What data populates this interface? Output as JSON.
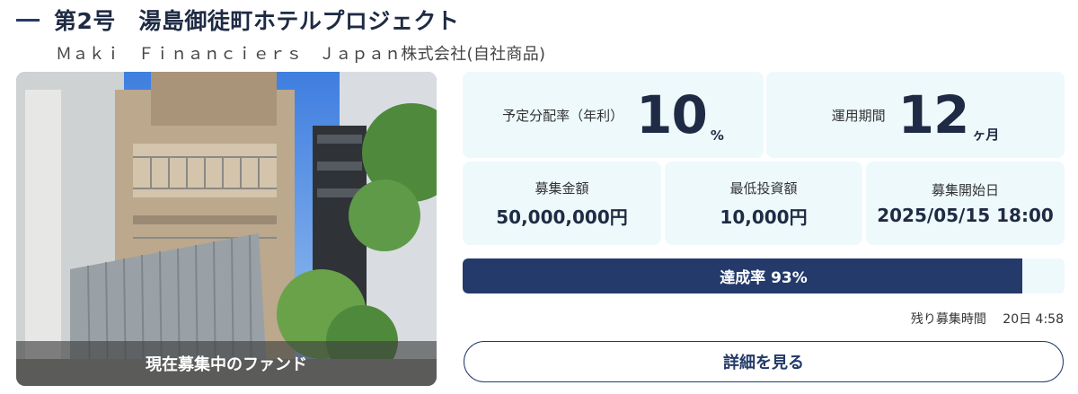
{
  "header": {
    "title": "第2号　湯島御徒町ホテルプロジェクト",
    "company": "Ｍａｋｉ　Ｆｉｎａｎｃｉｅｒｓ　Ｊａｐａｎ株式会社(自社商品)"
  },
  "photo": {
    "caption": "現在募集中のファンド"
  },
  "stats": {
    "distribution_label": "予定分配率（年利）",
    "distribution_value": "10",
    "distribution_unit": "%",
    "period_label": "運用期間",
    "period_value": "12",
    "period_unit": "ヶ月",
    "amount_label": "募集金額",
    "amount_value": "50,000,000円",
    "min_invest_label": "最低投資額",
    "min_invest_value": "10,000円",
    "start_label": "募集開始日",
    "start_value": "2025/05/15 18:00"
  },
  "progress": {
    "label": "達成率 93%",
    "percent": 93
  },
  "remaining": {
    "label": "残り募集時間",
    "value": "20日 4:58"
  },
  "detail_button": "詳細を見る",
  "colors": {
    "navy": "#243a6a",
    "panel": "#eef9fc"
  }
}
